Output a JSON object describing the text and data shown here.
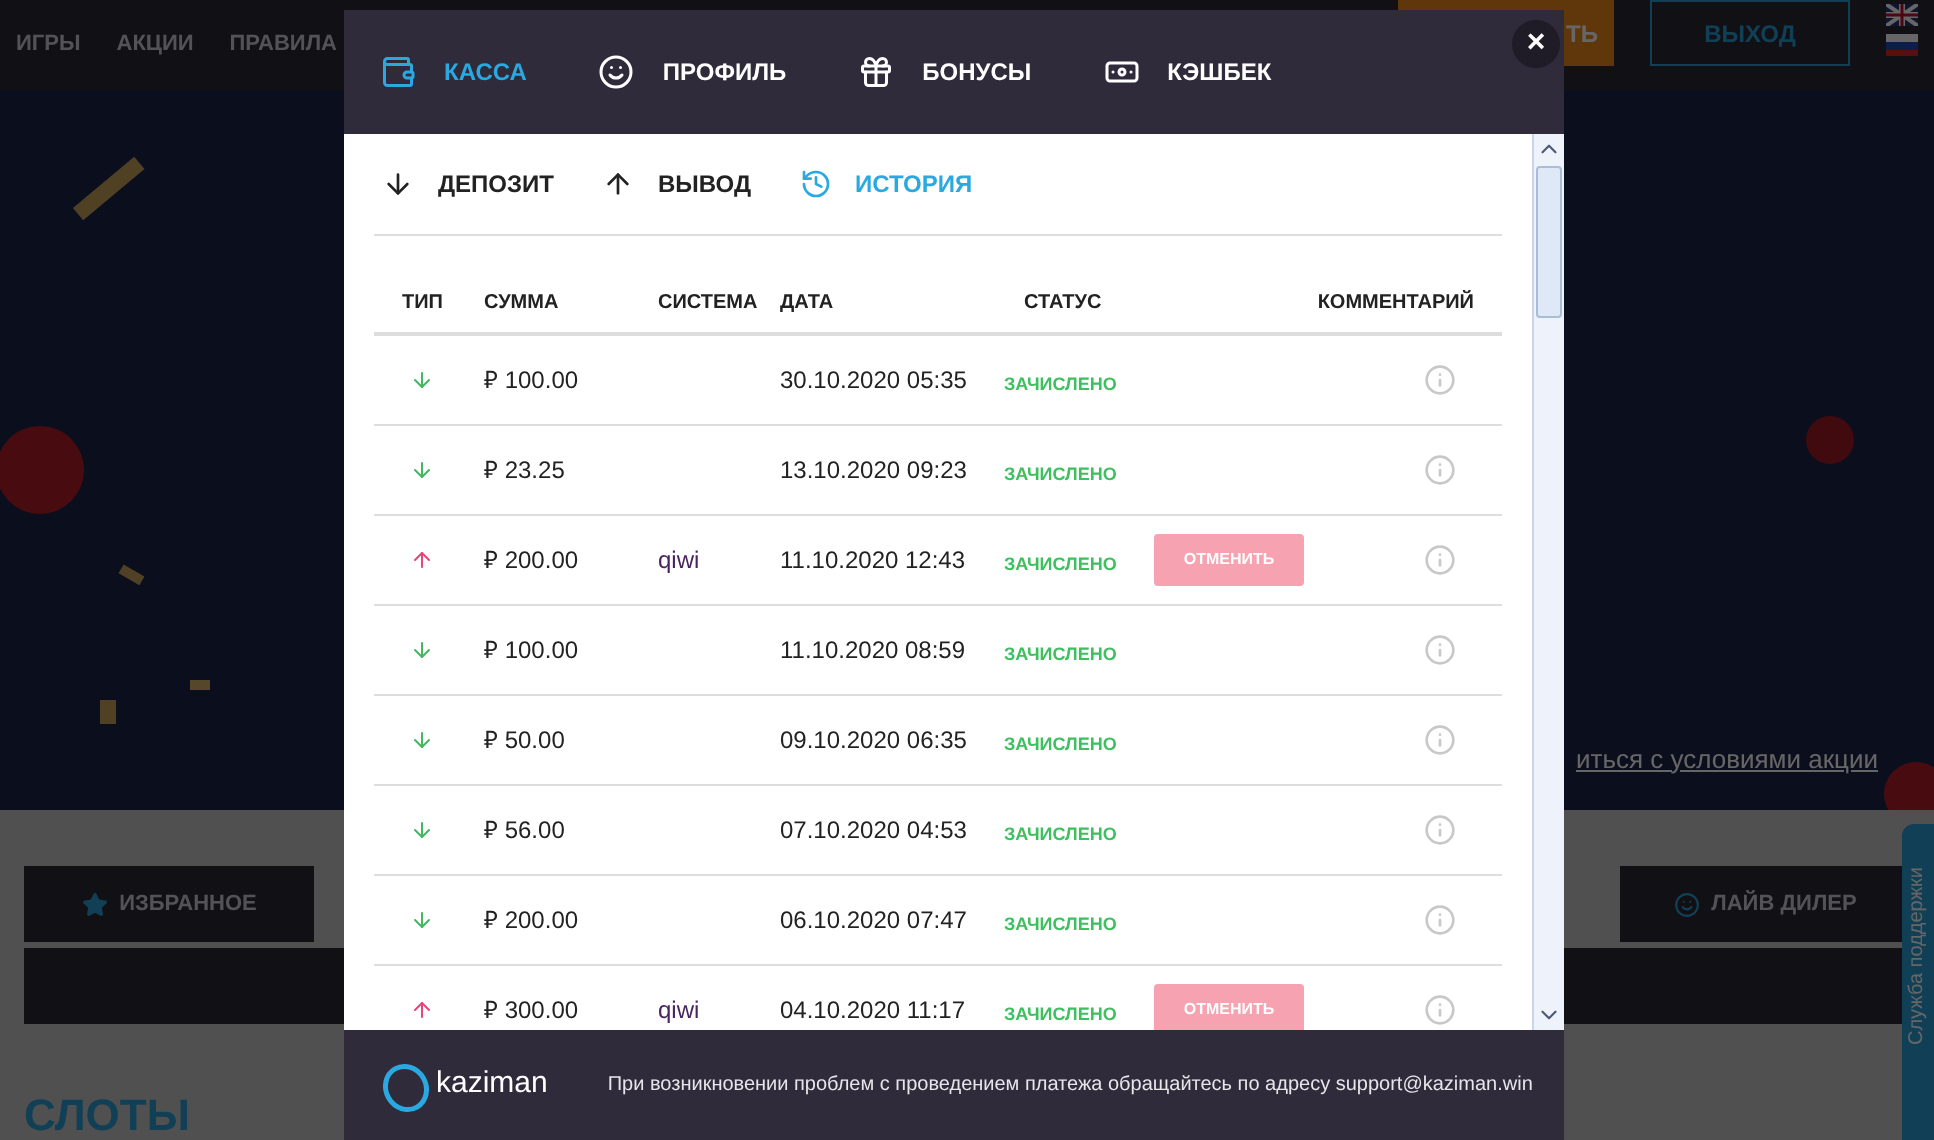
{
  "site_nav": {
    "items": [
      "ИГРЫ",
      "АКЦИИ",
      "ПРАВИЛА"
    ],
    "deposit_button": "ТЬ",
    "logout_button": "ВЫХОД"
  },
  "banner": {
    "link": "иться с условиями акции"
  },
  "categories": [
    {
      "label": "ИЗБРАННОЕ",
      "kind": "star"
    },
    {
      "label": "ЛАЙВ ДИЛЕР",
      "kind": "live"
    }
  ],
  "section_title": "СЛОТЫ",
  "support_tab": "Служба поддержки",
  "modal": {
    "tabs": [
      {
        "label": "КАССА",
        "kind": "wallet",
        "selected": true
      },
      {
        "label": "ПРОФИЛЬ",
        "kind": "profile",
        "selected": false
      },
      {
        "label": "БОНУСЫ",
        "kind": "gift",
        "selected": false
      },
      {
        "label": "КЭШБЕК",
        "kind": "cash",
        "selected": false
      }
    ],
    "close": "×",
    "subtabs": [
      {
        "label": "ДЕПОЗИТ",
        "kind": "down",
        "selected": false
      },
      {
        "label": "ВЫВОД",
        "kind": "up",
        "selected": false
      },
      {
        "label": "ИСТОРИЯ",
        "kind": "history",
        "selected": true
      }
    ],
    "table": {
      "columns": [
        "ТИП",
        "СУММА",
        "СИСТЕМА",
        "ДАТА",
        "СТАТУС",
        "КОММЕНТАРИЙ"
      ],
      "rows": [
        {
          "kind": "in",
          "amount": "₽ 100.00",
          "date": "30.10.2020 05:35",
          "status": "ЗАЧИСЛЕНО"
        },
        {
          "kind": "in",
          "amount": "₽ 23.25",
          "date": "13.10.2020 09:23",
          "status": "ЗАЧИСЛЕНО"
        },
        {
          "kind": "out",
          "amount": "₽ 200.00",
          "system": "qiwi",
          "date": "11.10.2020 12:43",
          "status": "ЗАЧИСЛЕНО",
          "action": "ОТМЕНИТЬ"
        },
        {
          "kind": "in",
          "amount": "₽ 100.00",
          "date": "11.10.2020 08:59",
          "status": "ЗАЧИСЛЕНО"
        },
        {
          "kind": "in",
          "amount": "₽ 50.00",
          "date": "09.10.2020 06:35",
          "status": "ЗАЧИСЛЕНО"
        },
        {
          "kind": "in",
          "amount": "₽ 56.00",
          "date": "07.10.2020 04:53",
          "status": "ЗАЧИСЛЕНО"
        },
        {
          "kind": "in",
          "amount": "₽ 200.00",
          "date": "06.10.2020 07:47",
          "status": "ЗАЧИСЛЕНО"
        },
        {
          "kind": "out",
          "amount": "₽ 300.00",
          "system": "qiwi",
          "date": "04.10.2020 11:17",
          "status": "ЗАЧИСЛЕНО",
          "action": "ОТМЕНИТЬ"
        }
      ]
    },
    "footer": {
      "logo": "kaziman",
      "note": "При возникновении проблем с проведением платежа обращайтесь по адресу support@kaziman.win"
    }
  }
}
